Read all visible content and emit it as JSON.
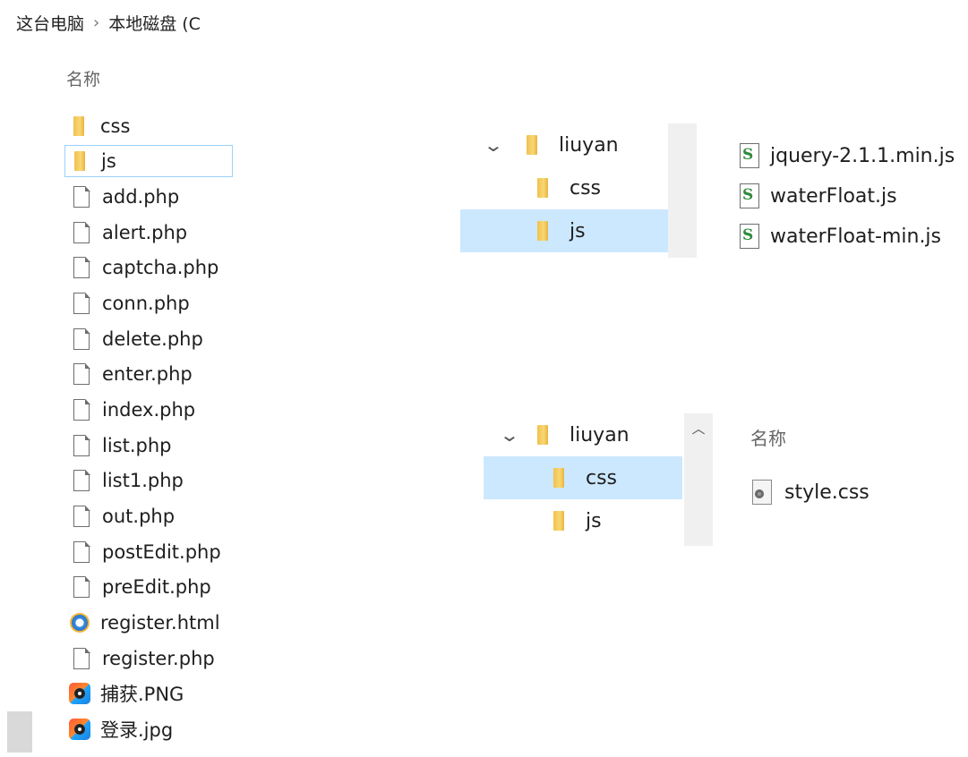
{
  "left": {
    "breadcrumb": [
      "这台电脑",
      "›",
      "本地磁盘 (C"
    ],
    "column_header": "名称",
    "items": [
      {
        "name": "css",
        "type": "folder",
        "icon": "folder-icon"
      },
      {
        "name": "js",
        "type": "folder",
        "icon": "folder-icon",
        "selected": true
      },
      {
        "name": "add.php",
        "type": "file",
        "icon": "file-icon"
      },
      {
        "name": "alert.php",
        "type": "file",
        "icon": "file-icon"
      },
      {
        "name": "captcha.php",
        "type": "file",
        "icon": "file-icon"
      },
      {
        "name": "conn.php",
        "type": "file",
        "icon": "file-icon"
      },
      {
        "name": "delete.php",
        "type": "file",
        "icon": "file-icon"
      },
      {
        "name": "enter.php",
        "type": "file",
        "icon": "file-icon"
      },
      {
        "name": "index.php",
        "type": "file",
        "icon": "file-icon"
      },
      {
        "name": "list.php",
        "type": "file",
        "icon": "file-icon"
      },
      {
        "name": "list1.php",
        "type": "file",
        "icon": "file-icon"
      },
      {
        "name": "out.php",
        "type": "file",
        "icon": "file-icon"
      },
      {
        "name": "postEdit.php",
        "type": "file",
        "icon": "file-icon"
      },
      {
        "name": "preEdit.php",
        "type": "file",
        "icon": "file-icon"
      },
      {
        "name": "register.html",
        "type": "html",
        "icon": "ie-icon"
      },
      {
        "name": "register.php",
        "type": "file",
        "icon": "file-icon"
      },
      {
        "name": "捕获.PNG",
        "type": "image",
        "icon": "image-icon"
      },
      {
        "name": "登录.jpg",
        "type": "image",
        "icon": "image-icon"
      }
    ]
  },
  "tree_top": {
    "root": "liuyan",
    "children": [
      "css",
      "js"
    ],
    "selected": "js"
  },
  "files_top": [
    {
      "name": "jquery-2.1.1.min.js",
      "icon": "js-script-icon"
    },
    {
      "name": "waterFloat.js",
      "icon": "js-script-icon"
    },
    {
      "name": "waterFloat-min.js",
      "icon": "js-script-icon"
    }
  ],
  "tree_bottom": {
    "root": "liuyan",
    "children": [
      "css",
      "js"
    ],
    "selected": "css"
  },
  "files_bottom": {
    "column_header": "名称",
    "items": [
      {
        "name": "style.css",
        "icon": "css-file-icon"
      }
    ]
  },
  "colors": {
    "selection_bg": "#cce8ff",
    "selection_border": "#99d1ff",
    "folder": "#f2c14e",
    "scroll_track": "#f0f0f0"
  }
}
